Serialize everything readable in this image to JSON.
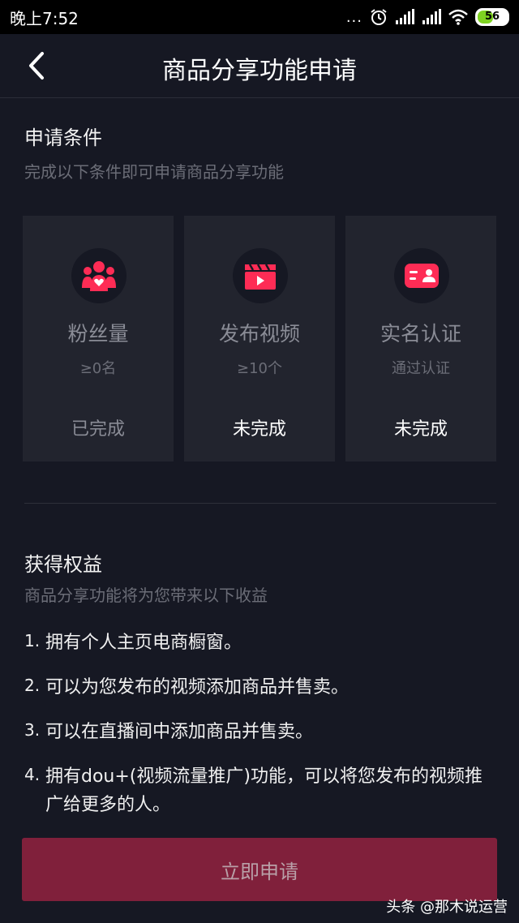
{
  "status_bar": {
    "time": "晚上7:52",
    "dots": "...",
    "battery": "56",
    "battery_level": 0.56
  },
  "header": {
    "title": "商品分享功能申请",
    "back_icon": "chevron-left-icon"
  },
  "conditions": {
    "title": "申请条件",
    "subtitle": "完成以下条件即可申请商品分享功能",
    "cards": [
      {
        "icon": "fans-icon",
        "label": "粉丝量",
        "requirement": "≥0名",
        "status": "已完成"
      },
      {
        "icon": "video-clapper-icon",
        "label": "发布视频",
        "requirement": "≥10个",
        "status": "未完成"
      },
      {
        "icon": "id-card-icon",
        "label": "实名认证",
        "requirement": "通过认证",
        "status": "未完成"
      }
    ]
  },
  "benefits": {
    "title": "获得权益",
    "subtitle": "商品分享功能将为您带来以下收益",
    "items": [
      {
        "num": "1.",
        "text": "拥有个人主页电商橱窗。"
      },
      {
        "num": "2.",
        "text": "可以为您发布的视频添加商品并售卖。"
      },
      {
        "num": "3.",
        "text": "可以在直播间中添加商品并售卖。"
      },
      {
        "num": "4.",
        "text": "拥有dou+(视频流量推广)功能，可以将您发布的视频推广给更多的人。"
      }
    ]
  },
  "apply_button": {
    "label": "立即申请"
  },
  "watermark": "头条 @那木说运营",
  "colors": {
    "background": "#161823",
    "card": "#22242e",
    "accent": "#fe2c55",
    "button": "#80203b"
  }
}
